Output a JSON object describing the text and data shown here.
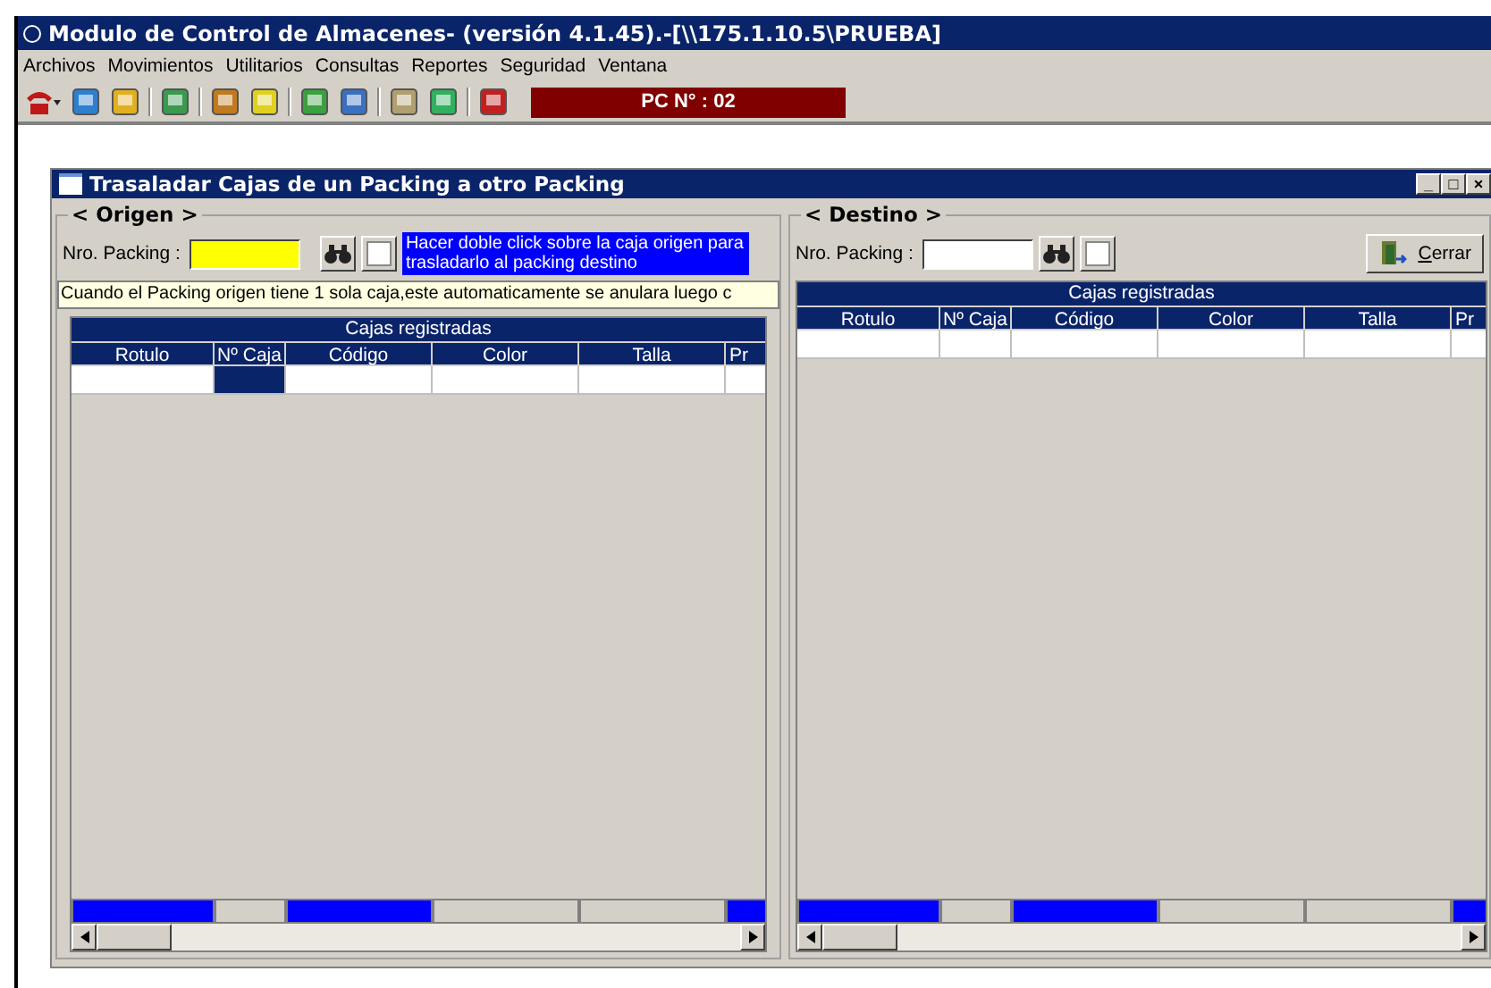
{
  "window": {
    "title": "Modulo de Control de Almacenes- (versión 4.1.45).-[\\\\175.1.10.5\\PRUEBA]"
  },
  "menu": [
    "Archivos",
    "Movimientos",
    "Utilitarios",
    "Consultas",
    "Reportes",
    "Seguridad",
    "Ventana"
  ],
  "toolbar": {
    "pc_label": "PC N° : 02"
  },
  "dialog": {
    "title": "Trasaladar Cajas de un Packing a otro Packing",
    "minimize": "_",
    "maximize": "□",
    "close": "×",
    "origin": {
      "legend": "< Origen >",
      "field_label": "Nro. Packing :",
      "hint": "Hacer doble click sobre la caja origen para trasladarlo al packing destino",
      "notice": "Cuando el Packing origen tiene 1 sola caja,este automaticamente se anulara luego c",
      "grid": {
        "caption": "Cajas registradas",
        "columns": [
          {
            "label": "Rotulo",
            "total_highlighted": true,
            "selected": false
          },
          {
            "label": "Nº Caja",
            "total_highlighted": false,
            "selected": true
          },
          {
            "label": "Código",
            "total_highlighted": true,
            "selected": false
          },
          {
            "label": "Color",
            "total_highlighted": false,
            "selected": false
          },
          {
            "label": "Talla",
            "total_highlighted": false,
            "selected": false
          },
          {
            "label": "Pr",
            "total_highlighted": true,
            "selected": false
          }
        ]
      }
    },
    "destination": {
      "legend": "< Destino >",
      "field_label": "Nro. Packing :",
      "close_button": "Cerrar",
      "grid": {
        "caption": "Cajas registradas",
        "columns": [
          {
            "label": "Rotulo",
            "total_highlighted": true,
            "selected": false
          },
          {
            "label": "Nº Caja",
            "total_highlighted": false,
            "selected": false
          },
          {
            "label": "Código",
            "total_highlighted": true,
            "selected": false
          },
          {
            "label": "Color",
            "total_highlighted": false,
            "selected": false
          },
          {
            "label": "Talla",
            "total_highlighted": false,
            "selected": false
          },
          {
            "label": "Pr",
            "total_highlighted": true,
            "selected": false
          }
        ]
      }
    }
  }
}
